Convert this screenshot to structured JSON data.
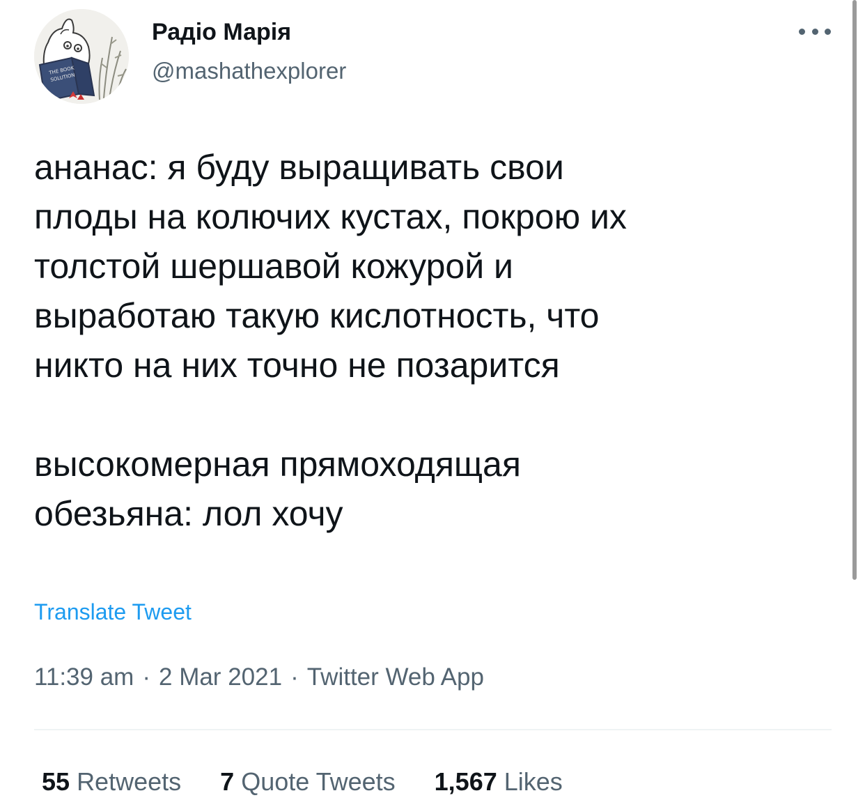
{
  "author": {
    "display_name": "Радіо Марія",
    "handle": "@mashathexplorer",
    "avatar_icon": "avatar-moomin-reading-icon",
    "avatar_book_lines": [
      "THE BOOK",
      "SOLUTION"
    ]
  },
  "more_icon": "more-options-icon",
  "tweet": {
    "text": "ананас: я буду выращивать свои\nплоды на колючих кустах, покрою их\nтолстой шершавой кожурой и\nвыработаю такую кислотность, что\nникто на них точно не позарится\n\nвысокомерная прямоходящая\nобезьяна: лол хочу",
    "translate_label": "Translate Tweet",
    "time": "11:39 am",
    "date": "2 Mar 2021",
    "source": "Twitter Web App",
    "separator": "·"
  },
  "stats": {
    "retweets_count": "55",
    "retweets_label": "Retweets",
    "quote_count": "7",
    "quote_label": "Quote Tweets",
    "likes_count": "1,567",
    "likes_label": "Likes"
  },
  "colors": {
    "text": "#0f1419",
    "secondary": "#536471",
    "link": "#1d9bf0",
    "divider": "#eff3f4"
  }
}
